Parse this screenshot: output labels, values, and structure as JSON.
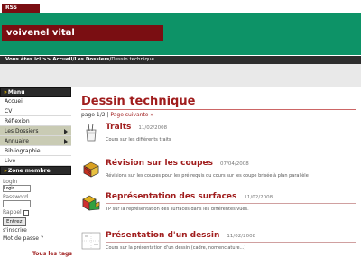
{
  "header": {
    "rss_label": "RSS",
    "site_title": "voivenel vital",
    "breadcrumb_prefix": "Vous êtes ici >> ",
    "breadcrumb_path": "Accueil/Les Dossiers/",
    "breadcrumb_current": "Dessin technique"
  },
  "sidebar": {
    "menu_title": "Menu",
    "items": [
      {
        "label": "Accueil"
      },
      {
        "label": "CV"
      },
      {
        "label": "Réflexion"
      },
      {
        "label": "Les Dossiers"
      },
      {
        "label": "Annuaire"
      },
      {
        "label": "Bibliographie"
      },
      {
        "label": "Live"
      }
    ],
    "member_title": "Zone membre",
    "login_label": "Login",
    "login_value": "Login",
    "password_label": "Password",
    "remember_label": "Rappel",
    "enter_button": "Entrez",
    "register_link": "s'inscrire",
    "forgot_link": "Mot de passe ?",
    "tags_link": "Tous les tags"
  },
  "main": {
    "title": "Dessin technique",
    "pager_text": "page 1/2 | ",
    "pager_next": "Page suivante »",
    "articles": [
      {
        "title": "Traits",
        "date": "11/02/2008",
        "description": "Cours sur les différents traits",
        "icon": "pencil-cup-icon"
      },
      {
        "title": "Révision sur les coupes",
        "date": "07/04/2008",
        "description": "Révisions sur les coupes pour les pré requis du cours sur les coupe brisée à plan parallèle",
        "icon": "cut-block-icon"
      },
      {
        "title": "Représentation des surfaces",
        "date": "11/02/2008",
        "description": "TP sur la représentation des surfaces dans les différentes vues.",
        "icon": "surface-block-icon"
      },
      {
        "title": "Présentation d'un dessin",
        "date": "11/02/2008",
        "description": "Cours sur la présentation d'un dessin (cadre, nomenclature...)",
        "icon": "drawing-sheet-icon"
      }
    ]
  },
  "colors": {
    "banner_green": "#0d9367",
    "brand_red": "#7a0e12",
    "title_red": "#a01d1d",
    "dark_bar": "#2d2d2d",
    "menu_highlight": "#c9cbb4"
  }
}
